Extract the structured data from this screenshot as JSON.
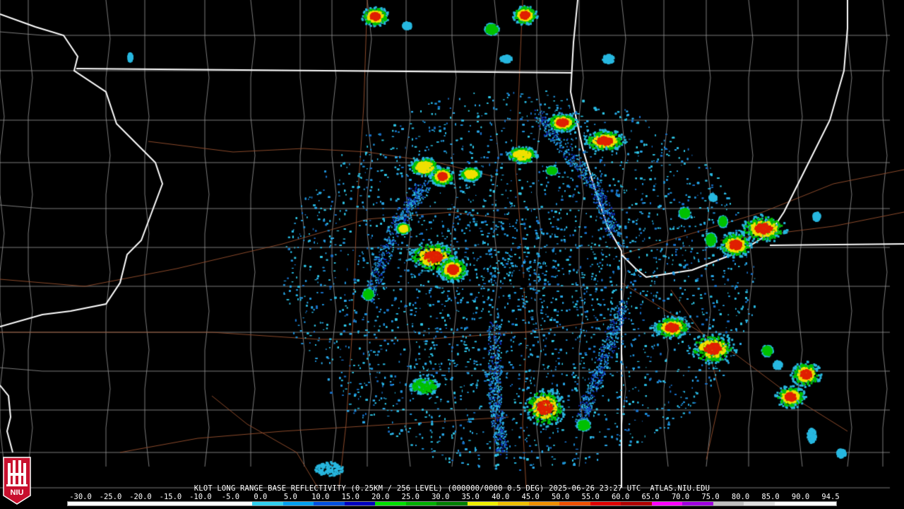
{
  "product": {
    "caption": "KLOT LONG RANGE BASE REFLECTIVITY (0.25KM / 256 LEVEL) (000000/0000 0.5 DEG) 2025-06-26 23:27 UTC  ATLAS.NIU.EDU"
  },
  "scale": {
    "labels": [
      "-30.0",
      "-25.0",
      "-20.0",
      "-15.0",
      "-10.0",
      "-5.0",
      "0.0",
      "5.0",
      "10.0",
      "15.0",
      "20.0",
      "25.0",
      "30.0",
      "35.0",
      "40.0",
      "45.0",
      "50.0",
      "55.0",
      "60.0",
      "65.0",
      "70.0",
      "75.0",
      "80.0",
      "85.0",
      "90.0",
      "94.5"
    ],
    "colors": [
      "#ffffff",
      "#ffffff",
      "#ffffff",
      "#ffffff",
      "#ffffff",
      "#ffffff",
      "#30d0f0",
      "#00a0f0",
      "#0050e0",
      "#0000c0",
      "#00e000",
      "#00b000",
      "#008000",
      "#f0f000",
      "#f0c000",
      "#f09000",
      "#f05000",
      "#e00000",
      "#b00000",
      "#ff00ff",
      "#a000e0",
      "#c0c0c0",
      "#e0e0e0",
      "#ffffff",
      "#ffffff"
    ]
  },
  "logo": {
    "text": "NIU",
    "colors": {
      "shield": "#c8102e",
      "text": "#ffffff"
    }
  },
  "map": {
    "colors": {
      "background": "#000000",
      "state_border": "#ffffff",
      "county_border": "#9a9a9a",
      "highway": "#8b4a2b",
      "echo_light": "#28b8e0",
      "echo_medium": "#00c000",
      "echo_strong": "#f0e000",
      "echo_heavy": "#e02000"
    },
    "radar_site": "KLOT"
  }
}
